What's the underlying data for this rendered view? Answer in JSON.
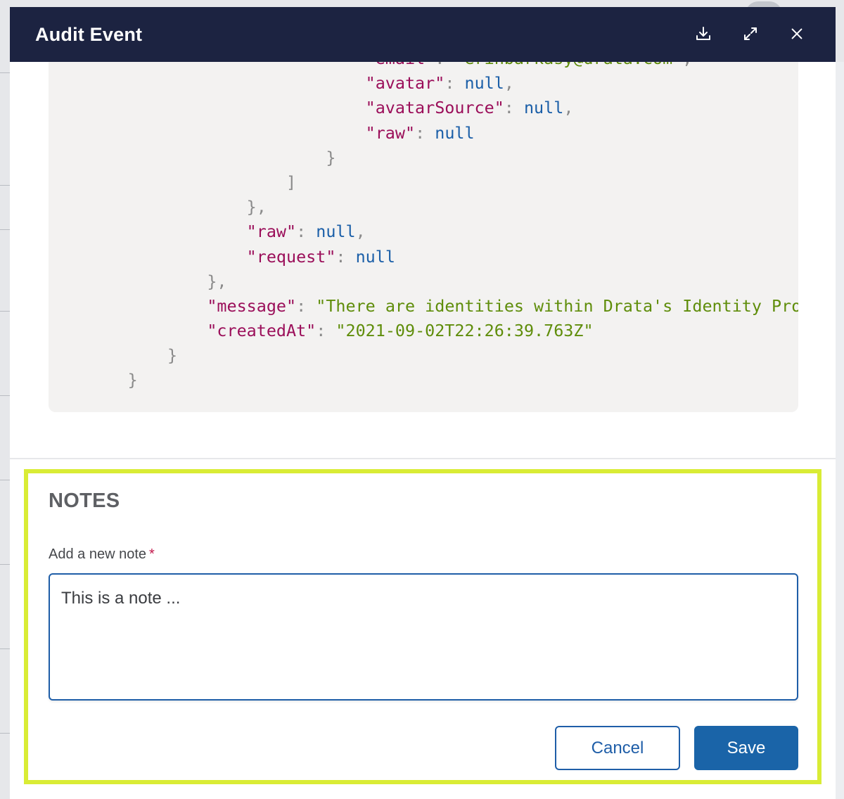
{
  "modal": {
    "title": "Audit Event",
    "header_actions": [
      {
        "name": "download-icon"
      },
      {
        "name": "expand-icon"
      },
      {
        "name": "close-icon"
      }
    ]
  },
  "code_viewer": {
    "colors": {
      "key": "#9b0f5a",
      "string": "#5f8d0a",
      "null": "#1b5fa8",
      "punctuation": "#8a8a8a",
      "background": "#f3f2f1"
    },
    "lines": [
      {
        "indent": 32,
        "tokens": [
          {
            "t": "key",
            "v": "\"email\""
          },
          {
            "t": "punct",
            "v": ": "
          },
          {
            "t": "str",
            "v": "\"erinbarkasy@drata.com\""
          },
          {
            "t": "punct",
            "v": ","
          }
        ]
      },
      {
        "indent": 32,
        "tokens": [
          {
            "t": "key",
            "v": "\"avatar\""
          },
          {
            "t": "punct",
            "v": ": "
          },
          {
            "t": "null",
            "v": "null"
          },
          {
            "t": "punct",
            "v": ","
          }
        ]
      },
      {
        "indent": 32,
        "tokens": [
          {
            "t": "key",
            "v": "\"avatarSource\""
          },
          {
            "t": "punct",
            "v": ": "
          },
          {
            "t": "null",
            "v": "null"
          },
          {
            "t": "punct",
            "v": ","
          }
        ]
      },
      {
        "indent": 32,
        "tokens": [
          {
            "t": "key",
            "v": "\"raw\""
          },
          {
            "t": "punct",
            "v": ": "
          },
          {
            "t": "null",
            "v": "null"
          }
        ]
      },
      {
        "indent": 28,
        "tokens": [
          {
            "t": "punct",
            "v": "}"
          }
        ]
      },
      {
        "indent": 24,
        "tokens": [
          {
            "t": "punct",
            "v": "]"
          }
        ]
      },
      {
        "indent": 20,
        "tokens": [
          {
            "t": "punct",
            "v": "},"
          }
        ]
      },
      {
        "indent": 20,
        "tokens": [
          {
            "t": "key",
            "v": "\"raw\""
          },
          {
            "t": "punct",
            "v": ": "
          },
          {
            "t": "null",
            "v": "null"
          },
          {
            "t": "punct",
            "v": ","
          }
        ]
      },
      {
        "indent": 20,
        "tokens": [
          {
            "t": "key",
            "v": "\"request\""
          },
          {
            "t": "punct",
            "v": ": "
          },
          {
            "t": "null",
            "v": "null"
          }
        ]
      },
      {
        "indent": 16,
        "tokens": [
          {
            "t": "punct",
            "v": "},"
          }
        ]
      },
      {
        "indent": 16,
        "tokens": [
          {
            "t": "key",
            "v": "\"message\""
          },
          {
            "t": "punct",
            "v": ": "
          },
          {
            "t": "str",
            "v": "\"There are identities within Drata's Identity Provider"
          }
        ]
      },
      {
        "indent": 16,
        "tokens": [
          {
            "t": "key",
            "v": "\"createdAt\""
          },
          {
            "t": "punct",
            "v": ": "
          },
          {
            "t": "str",
            "v": "\"2021-09-02T22:26:39.763Z\""
          }
        ]
      },
      {
        "indent": 12,
        "tokens": [
          {
            "t": "punct",
            "v": "}"
          }
        ]
      },
      {
        "indent": 8,
        "tokens": [
          {
            "t": "punct",
            "v": "}"
          }
        ]
      }
    ]
  },
  "notes": {
    "title": "NOTES",
    "field_label": "Add a new note",
    "required_marker": "*",
    "value": "This is a note ...",
    "cancel_label": "Cancel",
    "save_label": "Save",
    "highlight_color": "#d9ec35"
  }
}
